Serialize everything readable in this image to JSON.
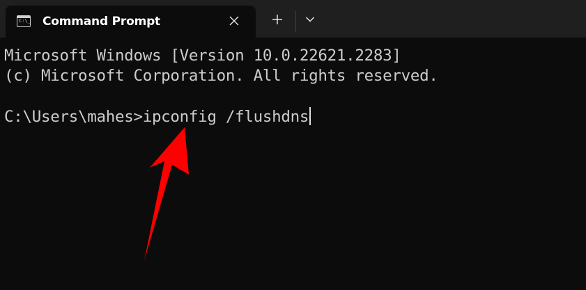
{
  "window": {
    "tab": {
      "title": "Command Prompt",
      "icon": "terminal-icon",
      "icon_prompt": "C:\\_"
    },
    "new_tab_icon": "plus-icon",
    "dropdown_icon": "chevron-down-icon",
    "close_icon": "close-icon"
  },
  "terminal": {
    "lines": [
      "Microsoft Windows [Version 10.0.22621.2283]",
      "(c) Microsoft Corporation. All rights reserved.",
      "C:\\Users\\mahes>ipconfig /flushdns"
    ]
  },
  "annotation": {
    "arrow_color": "#ff0000"
  }
}
